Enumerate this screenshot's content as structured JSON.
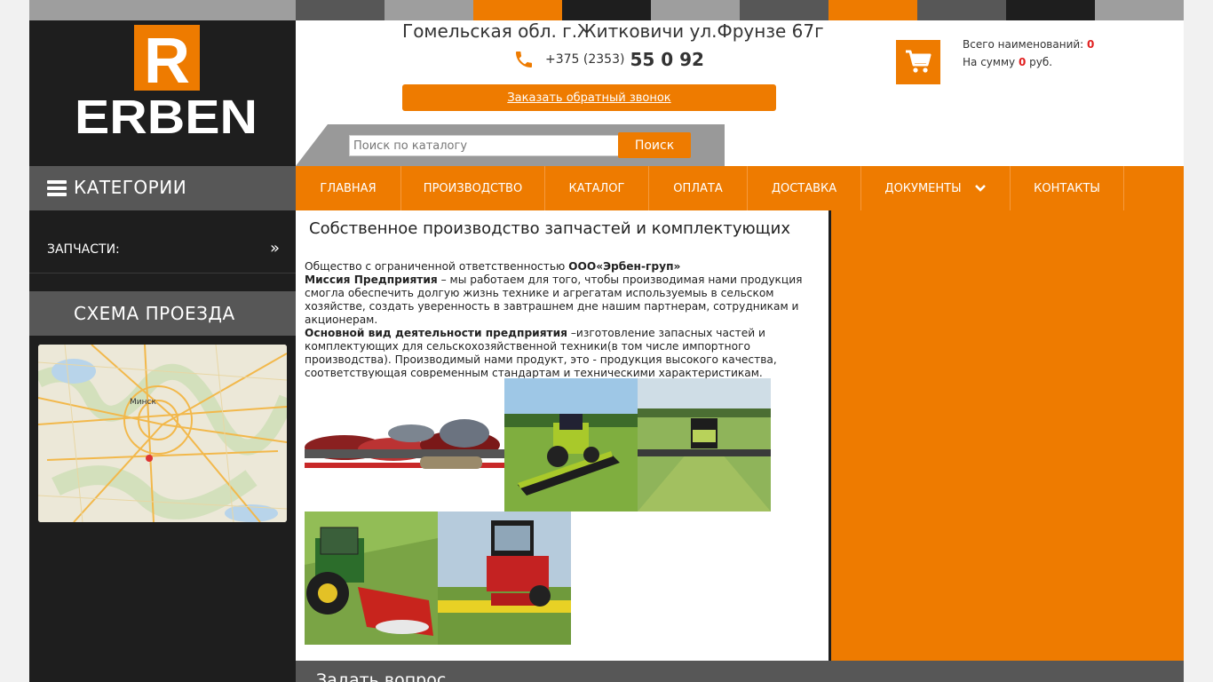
{
  "header": {
    "address": "Гомельская обл. г.Житковичи ул.Фрунзе 67г",
    "phone_prefix": "+375 (2353)",
    "phone_number": "55 0 92",
    "callback_label": "Заказать обратный звонок"
  },
  "search": {
    "placeholder": "Поиск по каталогу",
    "button_label": "Поиск"
  },
  "cart": {
    "items_label": "Всего наименований:",
    "items_count": "0",
    "sum_label": "На сумму",
    "sum_value": "0",
    "currency": "руб."
  },
  "logo": {
    "text": "ERBEN",
    "letter": "R"
  },
  "sidebar": {
    "categories_title": "КАТЕГОРИИ",
    "items": [
      {
        "label": "ЗАПЧАСТИ:"
      }
    ],
    "map_title": "СХЕМА ПРОЕЗДА",
    "map_city": "Минск"
  },
  "nav": {
    "items": [
      {
        "label": "ГЛАВНАЯ"
      },
      {
        "label": "ПРОИЗВОДСТВО"
      },
      {
        "label": "КАТАЛОГ"
      },
      {
        "label": "ОПЛАТА"
      },
      {
        "label": "ДОСТАВКА"
      },
      {
        "label": "ДОКУМЕНТЫ"
      },
      {
        "label": "КОНТАКТЫ"
      }
    ]
  },
  "content": {
    "title": "Собственное производство запчастей и комплектующих",
    "line1_text": "Общество с ограниченной ответственностью ",
    "line1_bold": "ООО«Эрбен-груп»",
    "mission_bold": "Миссия Предприятия",
    "mission_text": " – мы работаем для того, чтобы производимая нами продукция смогла обеспечить долгую жизнь технике и агрегатам используемыь в сельском хозяйстве, создать уверенность в завтрашнем дне нашим партнерам, сотрудникам и акционерам.",
    "activity_bold": "Основной вид деятельности предприятия",
    "activity_text": " –изготовление запасных частей и комплектующих для сельскохозяйственной техники(в том числе импортного производства). Производимый нами продукт, это - продукция высокого качества, соответствующая современным стандартам и техническими характеристикам."
  },
  "footer": {
    "ask_title": "Задать вопрос"
  },
  "colors": {
    "accent": "#ee7b00",
    "dark": "#1e1e1e",
    "gray": "#575757",
    "red": "#e02020"
  }
}
